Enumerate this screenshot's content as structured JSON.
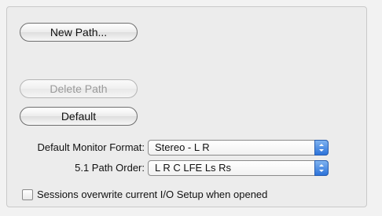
{
  "buttons": {
    "new_path": "New Path...",
    "delete_path": "Delete Path",
    "default": "Default"
  },
  "monitor_format": {
    "label": "Default Monitor Format:",
    "value": "Stereo - L R"
  },
  "path_order": {
    "label": "5.1 Path Order:",
    "value": "L R C LFE Ls Rs"
  },
  "sessions_overwrite": {
    "label": "Sessions overwrite current I/O Setup when opened",
    "checked": false
  },
  "colors": {
    "accent": "#2c72d9",
    "panel_bg": "#ececec"
  }
}
